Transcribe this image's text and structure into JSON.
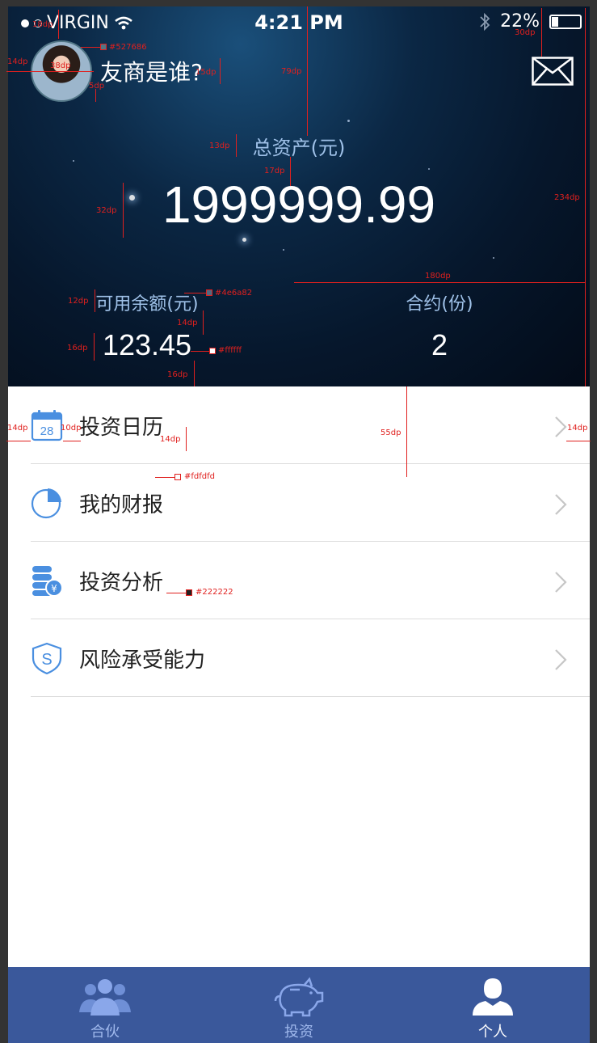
{
  "status_bar": {
    "carrier": "VIRGIN",
    "time": "4:21 PM",
    "battery": "22%"
  },
  "profile": {
    "nickname": "友商是谁?"
  },
  "assets": {
    "total_label": "总资产(元)",
    "total_value": "1999999.99",
    "available_label": "可用余额(元)",
    "available_value": "123.45",
    "contracts_label": "合约(份)",
    "contracts_value": "2"
  },
  "menu": {
    "items": [
      {
        "label": "投资日历",
        "icon": "calendar-icon",
        "icon_text": "28"
      },
      {
        "label": "我的财报",
        "icon": "pie-chart-icon"
      },
      {
        "label": "投资分析",
        "icon": "coins-icon",
        "icon_text": "¥"
      },
      {
        "label": "风险承受能力",
        "icon": "shield-icon",
        "icon_text": "S"
      }
    ]
  },
  "tabs": [
    {
      "label": "合伙",
      "icon": "partners-icon",
      "active": false
    },
    {
      "label": "投资",
      "icon": "piggy-bank-icon",
      "active": false
    },
    {
      "label": "个人",
      "icon": "person-icon",
      "active": true
    }
  ],
  "colors": {
    "avatar_border": "#527686",
    "label_blue": "#4e6a82",
    "value_white": "#ffffff",
    "row_bg": "#fdfdfd",
    "row_text": "#222222",
    "tab_bar": "#3a589b",
    "icon_blue": "#4a8fe0"
  },
  "annotations": {
    "status_margin": "18dp",
    "status_right": "30dp",
    "avatar_left": "14dp",
    "avatar_size": "38dp",
    "avatar_gap": "5dp",
    "nickname_size": "15dp",
    "header_gap": "79dp",
    "total_label_size": "13dp",
    "total_gap": "17dp",
    "total_value_size": "32dp",
    "header_height": "234dp",
    "column_width": "180dp",
    "sub_label_size": "12dp",
    "sub_gap": "14dp",
    "sub_value_size": "16dp",
    "sub_bottom": "16dp",
    "row_left": "14dp",
    "icon_gap": "10dp",
    "row_text_size": "14dp",
    "row_height": "55dp",
    "row_right": "14dp",
    "color_avatar": "#527686",
    "color_label": "#4e6a82",
    "color_value": "#ffffff",
    "color_row": "#fdfdfd",
    "color_text": "#222222"
  }
}
